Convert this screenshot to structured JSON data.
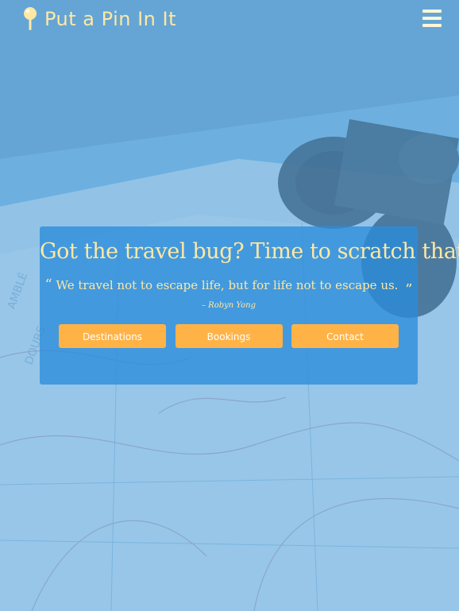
{
  "brand": {
    "name": "Put a Pin In It",
    "icon": "map-pin-icon"
  },
  "nav": {
    "menu_icon": "hamburger-menu-icon"
  },
  "hero": {
    "title": "Got the travel bug? Time to scratch that itch!",
    "quote_open": "“",
    "quote": "We travel not to escape life, but for life not to escape us.",
    "quote_close": "”",
    "author": "– Robyn Yong",
    "buttons": [
      {
        "label": "Destinations"
      },
      {
        "label": "Bookings"
      },
      {
        "label": "Contact"
      }
    ]
  },
  "colors": {
    "accent_text": "#ffe8a3",
    "button": "#ffb347",
    "card": "#2c8cda",
    "overlay": "#60aae2"
  }
}
